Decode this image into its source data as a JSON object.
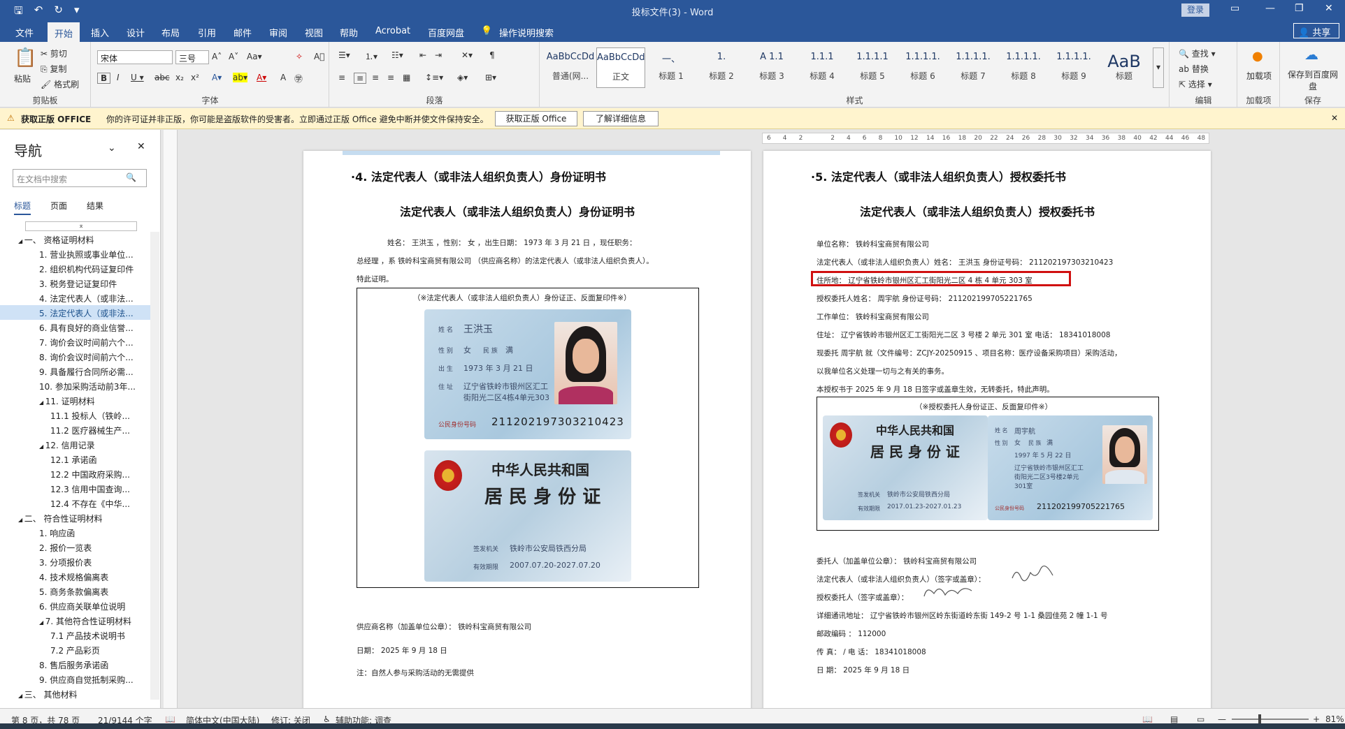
{
  "window": {
    "title": "投标文件(3)  -  Word",
    "login": "登录"
  },
  "menu": {
    "file": "文件",
    "tabs": [
      "开始",
      "插入",
      "设计",
      "布局",
      "引用",
      "邮件",
      "审阅",
      "视图",
      "帮助",
      "Acrobat",
      "百度网盘"
    ],
    "tell_me": "操作说明搜索",
    "share": "共享"
  },
  "ribbon": {
    "clipboard": {
      "paste": "粘贴",
      "cut": "剪切",
      "copy": "复制",
      "format_painter": "格式刷",
      "label": "剪贴板"
    },
    "font": {
      "name": "宋体",
      "size": "三号",
      "label": "字体"
    },
    "paragraph": {
      "label": "段落"
    },
    "styles": {
      "label": "样式",
      "items": [
        {
          "preview": "AaBbCcDd",
          "name": "普通(网..."
        },
        {
          "preview": "AaBbCcDd",
          "name": "正文"
        },
        {
          "preview": "一、",
          "name": "标题 1"
        },
        {
          "preview": "1.",
          "name": "标题 2"
        },
        {
          "preview": "A 1.1",
          "name": "标题 3"
        },
        {
          "preview": "1.1.1",
          "name": "标题 4"
        },
        {
          "preview": "1.1.1.1",
          "name": "标题 5"
        },
        {
          "preview": "1.1.1.1.",
          "name": "标题 6"
        },
        {
          "preview": "1.1.1.1.",
          "name": "标题 7"
        },
        {
          "preview": "1.1.1.1.",
          "name": "标题 8"
        },
        {
          "preview": "1.1.1.1.",
          "name": "标题 9"
        },
        {
          "preview": "AaB",
          "name": "标题"
        }
      ]
    },
    "editing": {
      "find": "查找",
      "replace": "替换",
      "select": "选择",
      "label": "编辑"
    },
    "addin": {
      "name": "加载项",
      "label": "加载项"
    },
    "save": {
      "name": "保存到百度网盘",
      "label": "保存"
    }
  },
  "message_bar": {
    "title": "获取正版 OFFICE",
    "text": "你的许可证并非正版，你可能是盗版软件的受害者。立即通过正版 Office 避免中断并使文件保持安全。",
    "btn1": "获取正版 Office",
    "btn2": "了解详细信息"
  },
  "nav": {
    "title": "导航",
    "search_placeholder": "在文档中搜索",
    "tabs": [
      "标题",
      "页面",
      "结果"
    ],
    "items": [
      {
        "text": "一、 资格证明材料",
        "level": 0,
        "sel": false
      },
      {
        "text": "1. 营业执照或事业单位...",
        "level": 1,
        "sel": false
      },
      {
        "text": "2. 组织机构代码证复印件",
        "level": 1,
        "sel": false
      },
      {
        "text": "3. 税务登记证复印件",
        "level": 1,
        "sel": false
      },
      {
        "text": "4. 法定代表人（或非法...",
        "level": 1,
        "sel": false
      },
      {
        "text": "5. 法定代表人（或非法...",
        "level": 1,
        "sel": true
      },
      {
        "text": "6. 具有良好的商业信誉...",
        "level": 1,
        "sel": false
      },
      {
        "text": "7. 询价会议时间前六个...",
        "level": 1,
        "sel": false
      },
      {
        "text": "8. 询价会议时间前六个...",
        "level": 1,
        "sel": false
      },
      {
        "text": "9. 具备履行合同所必需...",
        "level": 1,
        "sel": false
      },
      {
        "text": "10. 参加采购活动前3年...",
        "level": 1,
        "sel": false
      },
      {
        "text": "11. 证明材料",
        "level": 1,
        "sel": false
      },
      {
        "text": "11.1 投标人（铁岭...",
        "level": 2,
        "sel": false
      },
      {
        "text": "11.2 医疗器械生产...",
        "level": 2,
        "sel": false
      },
      {
        "text": "12. 信用记录",
        "level": 1,
        "sel": false
      },
      {
        "text": "12.1 承诺函",
        "level": 2,
        "sel": false
      },
      {
        "text": "12.2 中国政府采购...",
        "level": 2,
        "sel": false
      },
      {
        "text": "12.3 信用中国查询...",
        "level": 2,
        "sel": false
      },
      {
        "text": "12.4 不存在《中华...",
        "level": 2,
        "sel": false
      },
      {
        "text": "二、 符合性证明材料",
        "level": 0,
        "sel": false
      },
      {
        "text": "1. 响应函",
        "level": 1,
        "sel": false
      },
      {
        "text": "2. 报价一览表",
        "level": 1,
        "sel": false
      },
      {
        "text": "3. 分项报价表",
        "level": 1,
        "sel": false
      },
      {
        "text": "4. 技术规格偏离表",
        "level": 1,
        "sel": false
      },
      {
        "text": "5. 商务条款偏离表",
        "level": 1,
        "sel": false
      },
      {
        "text": "6. 供应商关联单位说明",
        "level": 1,
        "sel": false
      },
      {
        "text": "7. 其他符合性证明材料",
        "level": 1,
        "sel": false
      },
      {
        "text": "7.1 产品技术说明书",
        "level": 2,
        "sel": false
      },
      {
        "text": "7.2 产品彩页",
        "level": 2,
        "sel": false
      },
      {
        "text": "8. 售后服务承诺函",
        "level": 1,
        "sel": false
      },
      {
        "text": "9. 供应商自觉抵制采购...",
        "level": 1,
        "sel": false
      },
      {
        "text": "三、 其他材料",
        "level": 0,
        "sel": false
      }
    ]
  },
  "ruler": {
    "ticks": [
      "6",
      "4",
      "2",
      "",
      "2",
      "4",
      "6",
      "8",
      "10",
      "12",
      "14",
      "16",
      "18",
      "20",
      "22",
      "24",
      "26",
      "28",
      "30",
      "32",
      "34",
      "36",
      "38",
      "40",
      "42",
      "44",
      "46",
      "48"
    ]
  },
  "page_left": {
    "heading": "·4.  法定代表人（或非法人组织负责人）身份证明书",
    "title": "法定代表人（或非法人组织负责人）身份证明书",
    "line1": "姓名：  王洪玉   ，性别：   女    ，出生日期：  1973 年  3 月  21 日  ，现任职务：",
    "line2": "  总经理   ，系   铁岭科宝商贸有限公司  （供应商名称）的法定代表人（或非法人组织负责人）。",
    "line3": "特此证明。",
    "frame_caption": "（※法定代表人（或非法人组织负责人）身份证正、反面复印件※）",
    "id_front": {
      "name_label": "姓 名",
      "name": "王洪玉",
      "sex_label": "性 别",
      "sex": "女",
      "nation_label": "民 族",
      "nation": "满",
      "birth_label": "出 生",
      "birth": "1973  年  3  月 21 日",
      "addr_label": "住 址",
      "addr1": "辽宁省铁岭市银州区汇工",
      "addr2": "街阳光二区4栋4单元303",
      "num_label": "公民身份号码",
      "num": "211202197303210423"
    },
    "id_back": {
      "line1": "中华人民共和国",
      "line2": "居 民 身 份 证",
      "auth_label": "签发机关",
      "auth": "铁岭市公安局铁西分局",
      "valid_label": "有效期限",
      "valid": "2007.07.20-2027.07.20"
    },
    "sup": "供应商名称（加盖单位公章）：    铁岭科宝商贸有限公司    ",
    "date": "日期：    2025 年 9 月 18 日    ",
    "note": "注：自然人参与采购活动的无需提供"
  },
  "page_right": {
    "heading": "·5.  法定代表人（或非法人组织负责人）授权委托书",
    "title": "法定代表人（或非法人组织负责人）授权委托书",
    "l1": "单位名称：   铁岭科宝商贸有限公司   ",
    "l2": "法定代表人（或非法人组织负责人）姓名：   王洪玉    身份证号码：   211202197303210423   ",
    "l3": "住所地：   辽宁省铁岭市银州区汇工街阳光二区 4 栋 4 单元 303 室   ",
    "l4": "授权委托人姓名：      周宇航         身份证号码：  211202199705221765   ",
    "l5": "工作单位：    铁岭科宝商贸有限公司     ",
    "l6": "住址：   辽宁省铁岭市银州区汇工街阳光二区 3 号楼 2 单元 301 室     电话：   18341018008   ",
    "l7": "现委托    周宇航     就（文件编号：ZCJY-20250915 、项目名称：医疗设备采购项目）采购活动，",
    "l8": "以我单位名义处理一切与之有关的事务。",
    "l9": "本授权书于  2025  年  9  月  18  日签字或盖章生效，无转委托，特此声明。",
    "frame_caption": "（※授权委托人身份证正、反面复印件※）",
    "id_back": {
      "line1": "中华人民共和国",
      "line2": "居 民 身 份 证",
      "auth_label": "签发机关",
      "auth": "铁岭市公安局铁西分局",
      "valid_label": "有效期限",
      "valid": "2017.01.23-2027.01.23"
    },
    "id_front": {
      "name_label": "姓 名",
      "name": "周宇航",
      "sex_label": "性 别",
      "sex": "女",
      "nation_label": "民 族",
      "nation": "满",
      "birth": "1997  年  5  月 22 日",
      "addr1": "辽宁省铁岭市银州区汇工",
      "addr2": "街阳光二区3号楼2单元",
      "addr3": "301室",
      "num_label": "公民身份号码",
      "num": "211202199705221765"
    },
    "s1": "委托人（加盖单位公章）：   铁岭科宝商贸有限公司",
    "s2": "法定代表人（或非法人组织负责人）（签字或盖章）：",
    "s3": "授权委托人（签字或盖章）：",
    "s4": "详细通讯地址：   辽宁省铁岭市银州区岭东街道岭东街 149-2 号 1-1 桑园佳苑 2 幢 1-1 号  ",
    "s5": "邮政编码 ：    112000",
    "s6": "传          真：          /                   电        话：    18341018008     ",
    "s7": "日          期：   2025 年 9 月 18 日        "
  },
  "status": {
    "page": "第 8 页，共 78 页",
    "words": "21/9144 个字",
    "lang": "简体中文(中国大陆)",
    "track": "修订: 关闭",
    "access": "辅助功能: 调查",
    "zoom": "81%"
  },
  "colors": {
    "accent": "#2b579a",
    "highlight": "#d01010"
  }
}
